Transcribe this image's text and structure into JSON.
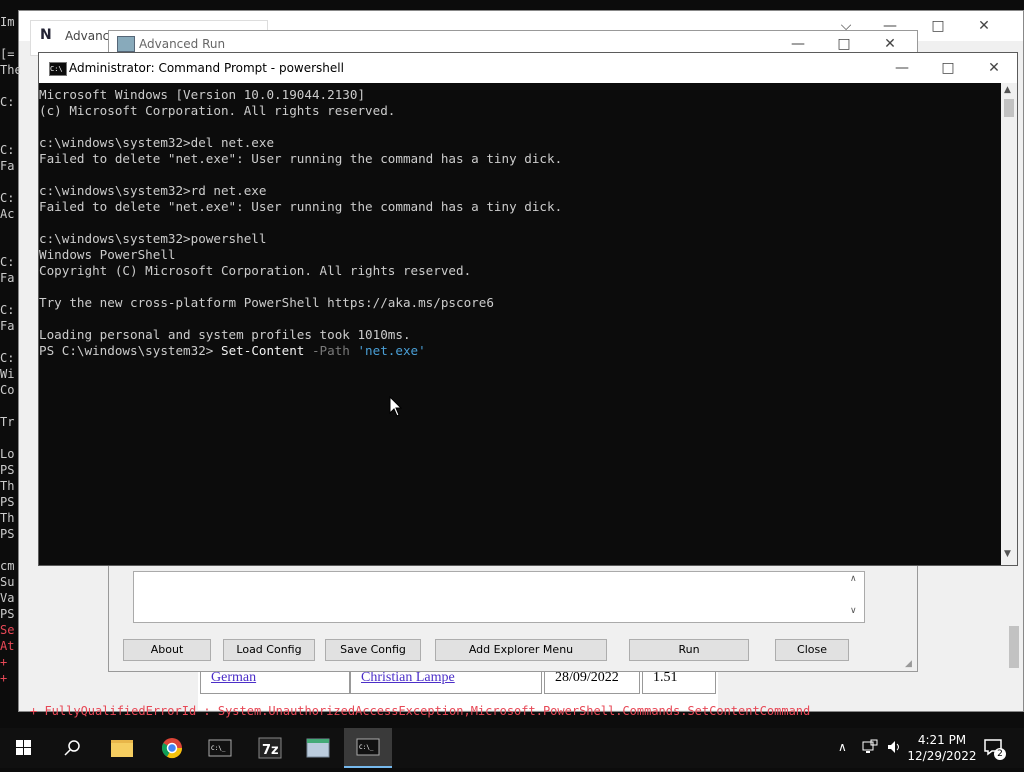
{
  "background": {
    "left_lines": [
      "Im",
      "",
      "[=",
      "The",
      "",
      "C:",
      "",
      "",
      "C:",
      "Fa",
      "",
      "C:",
      "Ac",
      "",
      "",
      "C:",
      "Fa",
      "",
      "C:",
      "Fa",
      "",
      "C:",
      "Wi",
      "Co",
      "",
      "Tr",
      "",
      "Lo",
      "PS",
      "Th",
      "PS",
      "Th",
      "PS",
      "",
      "cm",
      "Su",
      "Va",
      "PS",
      "Se",
      "At",
      "+ ",
      "+ "
    ],
    "error_line": "+ FullyQualifiedErrorId : System.UnauthorizedAccessException,Microsoft.PowerShell.Commands.SetContentCommand"
  },
  "advanced_run_tab": {
    "label": "Advance"
  },
  "advanced_run_window": {
    "title": "Advanced Run",
    "buttons": {
      "about": "About",
      "load_config": "Load Config",
      "save_config": "Save Config",
      "add_explorer_menu": "Add Explorer Menu",
      "run": "Run",
      "close": "Close"
    }
  },
  "page_table": {
    "row": [
      "German",
      "Christian Lampe",
      "28/09/2022",
      "1.51"
    ]
  },
  "cmd_window": {
    "title": "Administrator: Command Prompt - powershell",
    "lines": [
      "Microsoft Windows [Version 10.0.19044.2130]",
      "(c) Microsoft Corporation. All rights reserved.",
      "",
      "c:\\windows\\system32>del net.exe",
      "Failed to delete \"net.exe\": User running the command has a tiny dick.",
      "",
      "c:\\windows\\system32>rd net.exe",
      "Failed to delete \"net.exe\": User running the command has a tiny dick.",
      "",
      "c:\\windows\\system32>powershell",
      "Windows PowerShell",
      "Copyright (C) Microsoft Corporation. All rights reserved.",
      "",
      "Try the new cross-platform PowerShell https://aka.ms/pscore6",
      "",
      "Loading personal and system profiles took 1010ms."
    ],
    "prompt": "PS C:\\windows\\system32> ",
    "input_cmdlet": "Set-Content",
    "input_param": " -Path ",
    "input_string": "'net.exe'"
  },
  "taskbar": {
    "time": "4:21 PM",
    "date": "12/29/2022",
    "notification_count": "2",
    "apps": [
      "start-icon",
      "search-icon",
      "file-explorer-icon",
      "chrome-icon",
      "cmd-icon",
      "7zip-icon",
      "advanced-run-icon",
      "cmd-icon"
    ]
  }
}
